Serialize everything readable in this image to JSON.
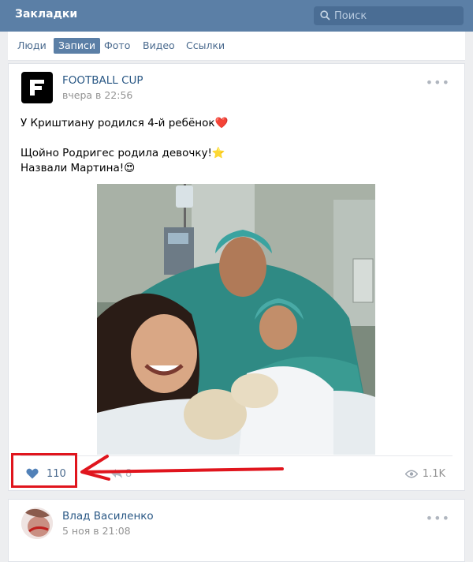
{
  "header": {
    "title": "Закладки"
  },
  "search": {
    "placeholder": "Поиск"
  },
  "tabs": [
    {
      "label": "Люди",
      "active": false
    },
    {
      "label": "Записи",
      "active": true
    },
    {
      "label": "Фото",
      "active": false
    },
    {
      "label": "Видео",
      "active": false
    },
    {
      "label": "Ссылки",
      "active": false
    }
  ],
  "posts": [
    {
      "author": "FOOTBALL CUP",
      "date": "вчера в 22:56",
      "text_lines": [
        "У Криштиану родился 4-й ребёнок❤️",
        "",
        "Щойно Родригес родила девочку!⭐",
        "Назвали Мартина!😍"
      ],
      "likes": "110",
      "shares": "8",
      "views": "1.1K"
    },
    {
      "author": "Влад Василенко",
      "date": "5 ноя в 21:08"
    }
  ],
  "colors": {
    "topbar": "#5b7fa6",
    "link": "#2a5885",
    "highlight": "#e0151d",
    "background": "#edeef0"
  },
  "icons": [
    "search-icon",
    "heart-icon",
    "share-icon",
    "eye-icon",
    "more-icon"
  ]
}
